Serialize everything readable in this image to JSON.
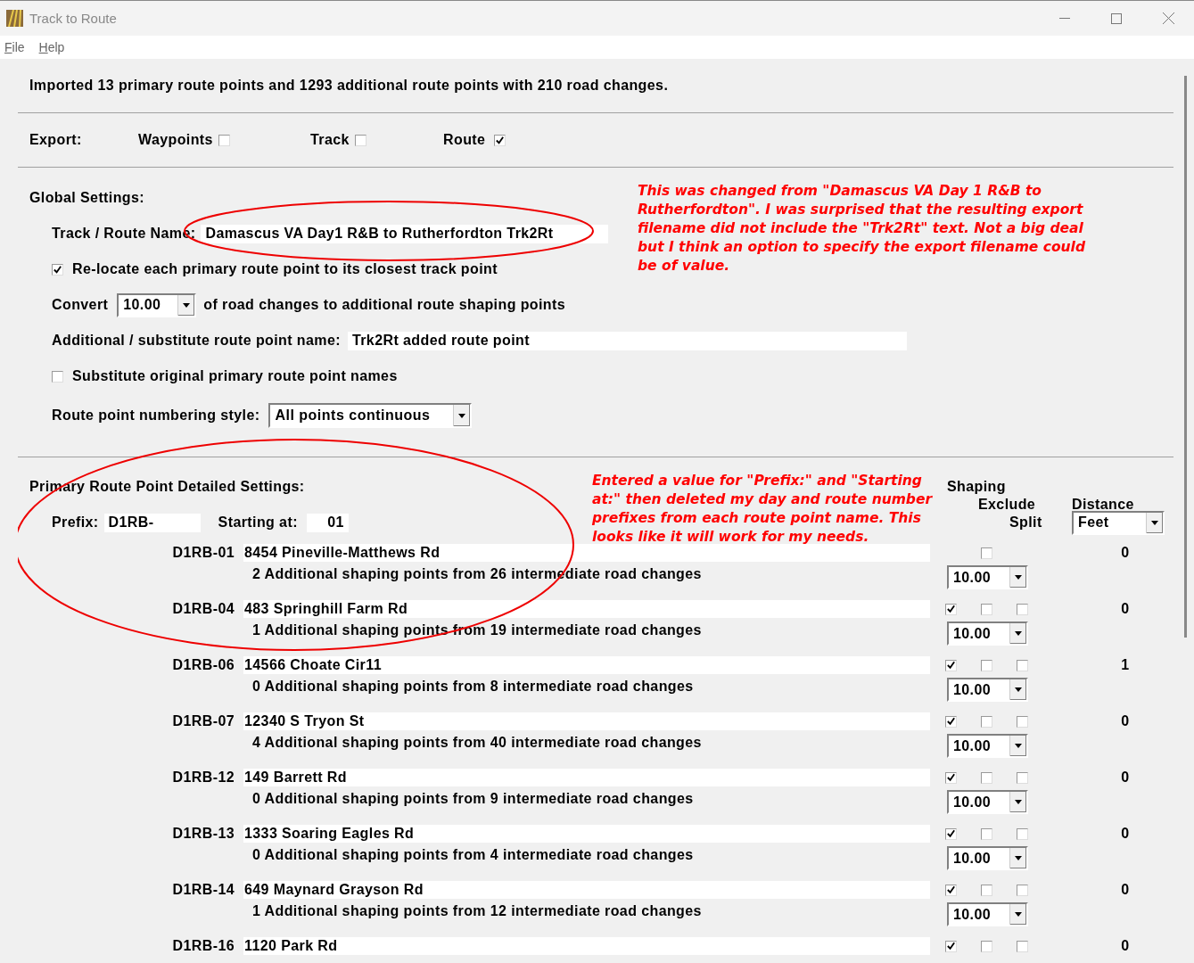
{
  "window": {
    "title": "Track to Route"
  },
  "menu": [
    {
      "label": "File"
    },
    {
      "label": "Help"
    }
  ],
  "summary": "Imported 13 primary route points and 1293 additional route points with 210 road changes.",
  "export": {
    "label": "Export:",
    "options": [
      {
        "label": "Waypoints",
        "checked": false
      },
      {
        "label": "Track",
        "checked": false
      },
      {
        "label": "Route",
        "checked": true
      }
    ]
  },
  "global_settings": {
    "heading": "Global Settings:",
    "track_route_name": {
      "label": "Track / Route Name:",
      "value": "Damascus VA Day1 R&B to Rutherfordton Trk2Rt"
    },
    "relocate": {
      "label": "Re-locate each primary route point to its closest track point",
      "checked": true
    },
    "convert": {
      "label": "Convert",
      "value": "10.00",
      "suffix": "of road changes to additional route shaping points"
    },
    "additional_name": {
      "label": "Additional / substitute route point name:",
      "value": "Trk2Rt added route point"
    },
    "substitute": {
      "label": "Substitute original primary route point names",
      "checked": false
    },
    "numbering_style": {
      "label": "Route point numbering style:",
      "value": "All points continuous"
    }
  },
  "detailed": {
    "heading": "Primary Route Point Detailed Settings:",
    "prefix": {
      "label": "Prefix:",
      "value": "D1RB-"
    },
    "starting_at": {
      "label": "Starting at:",
      "value": "01"
    },
    "columns": {
      "shaping": "Shaping",
      "exclude": "Exclude",
      "split": "Split",
      "distance": "Distance"
    },
    "distance_unit": "Feet",
    "points": [
      {
        "name": "D1RB-01",
        "address": "8454 Pineville-Matthews Rd",
        "exclude": false,
        "distance": "0",
        "summary": "2 Additional shaping points from 26 intermediate road changes",
        "spacing": "10.00"
      },
      {
        "name": "D1RB-04",
        "address": "483 Springhill Farm Rd",
        "shaping": true,
        "exclude": false,
        "split": false,
        "distance": "0",
        "summary": "1 Additional shaping points from 19 intermediate road changes",
        "spacing": "10.00"
      },
      {
        "name": "D1RB-06",
        "address": "14566 Choate Cir11",
        "shaping": true,
        "exclude": false,
        "split": false,
        "distance": "1",
        "summary": "0 Additional shaping points from 8 intermediate road changes",
        "spacing": "10.00"
      },
      {
        "name": "D1RB-07",
        "address": "12340 S Tryon St",
        "shaping": true,
        "exclude": false,
        "split": false,
        "distance": "0",
        "summary": "4 Additional shaping points from 40 intermediate road changes",
        "spacing": "10.00"
      },
      {
        "name": "D1RB-12",
        "address": "149 Barrett Rd",
        "shaping": true,
        "exclude": false,
        "split": false,
        "distance": "0",
        "summary": "0 Additional shaping points from 9 intermediate road changes",
        "spacing": "10.00"
      },
      {
        "name": "D1RB-13",
        "address": "1333 Soaring Eagles Rd",
        "shaping": true,
        "exclude": false,
        "split": false,
        "distance": "0",
        "summary": "0 Additional shaping points from 4 intermediate road changes",
        "spacing": "10.00"
      },
      {
        "name": "D1RB-14",
        "address": "649 Maynard Grayson Rd",
        "shaping": true,
        "exclude": false,
        "split": false,
        "distance": "0",
        "summary": "1 Additional shaping points from 12 intermediate road changes",
        "spacing": "10.00"
      },
      {
        "name": "D1RB-16",
        "address": "1120 Park Rd",
        "shaping": true,
        "exclude": false,
        "split": false,
        "distance": "0"
      }
    ]
  },
  "annotations": [
    {
      "text": "This was changed from \"Damascus VA Day 1 R&B to Rutherfordton\".  I was surprised that the resulting export filename did not include the \"Trk2Rt\" text.  Not a big deal but I think an option to specify the export filename could be of value."
    },
    {
      "text": "Entered a value for \"Prefix:\" and \"Starting at:\" then deleted my day and route number prefixes from each route point name.  This looks like it will work for my needs."
    }
  ]
}
